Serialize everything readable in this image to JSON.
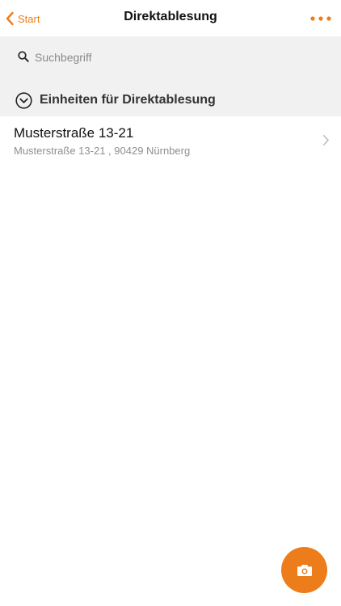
{
  "nav": {
    "back_label": "Start",
    "title": "Direktablesung",
    "more_icon": "more-dots-icon"
  },
  "search": {
    "placeholder": "Suchbegriff",
    "value": "",
    "icon": "search-icon"
  },
  "section": {
    "title": "Einheiten für Direktablesung",
    "icon": "chevron-down-circle-icon",
    "expanded": true
  },
  "list": {
    "items": [
      {
        "title": "Musterstraße 13-21",
        "subtitle": "Musterstraße 13-21 , 90429 Nürnberg"
      }
    ]
  },
  "fab": {
    "icon": "camera-icon"
  },
  "colors": {
    "accent": "#EC7D1A",
    "section_background": "#F1F1F1",
    "subtitle_text": "#8F8F8F"
  }
}
